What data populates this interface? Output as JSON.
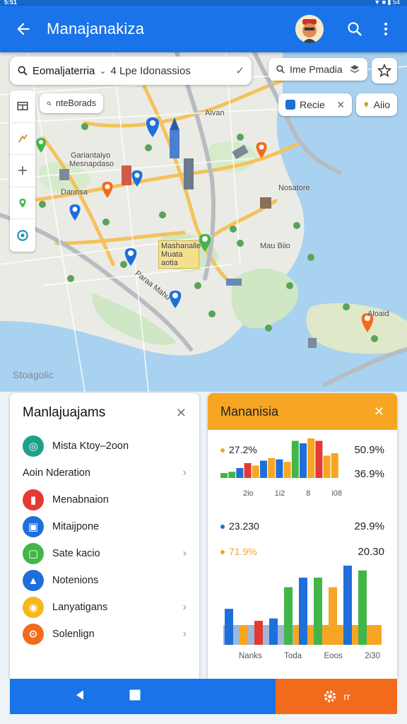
{
  "status": {
    "time": "5:51",
    "right": "▼ ■ ▮ 54"
  },
  "appbar": {
    "title": "Manajanakiza"
  },
  "search": {
    "selected": "Eomaljaterria",
    "query": "4 Lpe Idonassios"
  },
  "chips": {
    "search_small": "nteBorads",
    "places": "Ime Pmadia",
    "route": "Recie",
    "alt": "Aiio"
  },
  "map_labels": {
    "a": "Aivan",
    "b": "Gariantaiyo",
    "c": "Mesnapdaso",
    "d": "Dannsa",
    "e": "Nosatore",
    "f": "Mau Biio",
    "g": "Mashanalle Muata aotia",
    "h": "Aloaid",
    "i": "Paraa Mahu",
    "footer": "Stoagolic"
  },
  "left_panel": {
    "title": "Manlajuajams",
    "items": [
      {
        "label": "Mista Ktoy–2oon",
        "color": "#1fa08c",
        "arrow": false,
        "icon": "globe-icon"
      },
      {
        "label": "Aoin Nderation",
        "color": "",
        "arrow": true,
        "icon": ""
      },
      {
        "label": "Menabnaion",
        "color": "#e53935",
        "arrow": false,
        "icon": "phone-icon"
      },
      {
        "label": "Mitaijpone",
        "color": "#1e6fd9",
        "arrow": false,
        "icon": "card-icon"
      },
      {
        "label": "Sate kacio",
        "color": "#43b649",
        "arrow": true,
        "icon": "chat-icon"
      },
      {
        "label": "Notenions",
        "color": "#1e6fd9",
        "arrow": false,
        "icon": "drop-icon"
      },
      {
        "label": "Lanyatigans",
        "color": "#f5b71b",
        "arrow": true,
        "icon": "bell-icon"
      },
      {
        "label": "Solenlign",
        "color": "#f26b1d",
        "arrow": true,
        "icon": "gear-icon"
      }
    ]
  },
  "right_panel": {
    "title": "Mananisia",
    "stats": {
      "s1_left": "27.2%",
      "s1_right": "50.9%",
      "s2_right": "36.9%",
      "s3_left": "23.230",
      "s3_right": "29.9%",
      "s4_left": "71.9%",
      "s4_right": "20.30"
    },
    "chart1_ticks": [
      "2io",
      "1i2",
      "8",
      "i08"
    ],
    "chart2_ticks": [
      "Nanks",
      "Toda",
      "Eoos",
      "2i30"
    ]
  },
  "chart_data": [
    {
      "type": "bar",
      "series": [
        {
          "values": [
            4,
            5,
            8,
            12,
            10,
            14,
            16,
            15,
            13,
            30,
            28,
            32,
            30,
            18,
            20
          ]
        }
      ],
      "colors": [
        "#43b649",
        "#43b649",
        "#1e6fd9",
        "#e53935",
        "#f6a623",
        "#1e6fd9",
        "#f6a623",
        "#1e6fd9",
        "#f6a623",
        "#43b649",
        "#1e6fd9",
        "#f6a623",
        "#e53935",
        "#f6a623",
        "#f6a623"
      ]
    },
    {
      "type": "bar",
      "series": [
        {
          "values": [
            30,
            16,
            20,
            22,
            48,
            56,
            56,
            48,
            66,
            62
          ]
        }
      ],
      "colors": [
        "#1e6fd9",
        "#f6a623",
        "#e53935",
        "#1e6fd9",
        "#43b649",
        "#1e6fd9",
        "#43b649",
        "#f6a623",
        "#1e6fd9",
        "#43b649"
      ]
    }
  ],
  "nav": {
    "settings_label": "rr"
  }
}
